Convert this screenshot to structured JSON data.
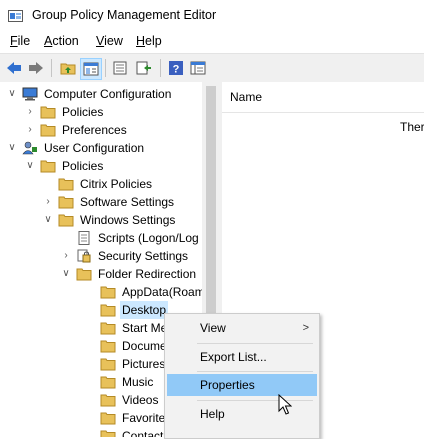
{
  "window": {
    "title": "Group Policy Management Editor"
  },
  "menubar": {
    "items": [
      {
        "label": "File",
        "key": "F",
        "rest": "ile"
      },
      {
        "label": "Action",
        "key": "A",
        "rest": "ction"
      },
      {
        "label": "View",
        "key": "V",
        "rest": "iew"
      },
      {
        "label": "Help",
        "key": "H",
        "rest": "elp"
      }
    ]
  },
  "toolbar": {
    "buttons": [
      "back-icon",
      "forward-icon",
      "up-folder-icon",
      "show-hide-tree-icon",
      "properties-icon",
      "export-list-icon",
      "help-icon",
      "show-hide-action-pane-icon"
    ]
  },
  "tree": {
    "items": [
      {
        "label": "Computer Configuration",
        "expander": "v",
        "icon": "computer-icon"
      },
      {
        "label": "Policies",
        "expander": ">",
        "icon": "folder-icon"
      },
      {
        "label": "Preferences",
        "expander": ">",
        "icon": "folder-icon"
      },
      {
        "label": "User Configuration",
        "expander": "v",
        "icon": "user-icon"
      },
      {
        "label": "Policies",
        "expander": "v",
        "icon": "folder-icon"
      },
      {
        "label": "Citrix Policies",
        "expander": "",
        "icon": "folder-icon"
      },
      {
        "label": "Software Settings",
        "expander": ">",
        "icon": "folder-icon"
      },
      {
        "label": "Windows Settings",
        "expander": "v",
        "icon": "folder-icon"
      },
      {
        "label": "Scripts (Logon/Log",
        "expander": "",
        "icon": "script-icon"
      },
      {
        "label": "Security Settings",
        "expander": ">",
        "icon": "security-icon"
      },
      {
        "label": "Folder Redirection",
        "expander": "v",
        "icon": "folder-icon"
      },
      {
        "label": "AppData(Roam",
        "expander": "",
        "icon": "folder-icon"
      },
      {
        "label": "Desktop",
        "expander": "",
        "icon": "folder-icon",
        "selected": true
      },
      {
        "label": "Start Me",
        "expander": "",
        "icon": "folder-icon"
      },
      {
        "label": "Docume",
        "expander": "",
        "icon": "folder-icon"
      },
      {
        "label": "Pictures",
        "expander": "",
        "icon": "folder-icon"
      },
      {
        "label": "Music",
        "expander": "",
        "icon": "folder-icon"
      },
      {
        "label": "Videos",
        "expander": "",
        "icon": "folder-icon"
      },
      {
        "label": "Favorite",
        "expander": "",
        "icon": "folder-icon"
      },
      {
        "label": "Contacts",
        "expander": "",
        "icon": "folder-icon"
      }
    ]
  },
  "rightpane": {
    "column_header": "Name",
    "text": "Ther"
  },
  "context_menu": {
    "items": [
      {
        "label": "View",
        "submenu": ">"
      },
      {
        "label": "Export List..."
      },
      {
        "label": "Properties",
        "hover": true
      },
      {
        "label": "Help"
      }
    ]
  },
  "colors": {
    "selection": "#cce8ff",
    "menu_hover": "#91c9f7",
    "folder": "#e8c15a"
  }
}
